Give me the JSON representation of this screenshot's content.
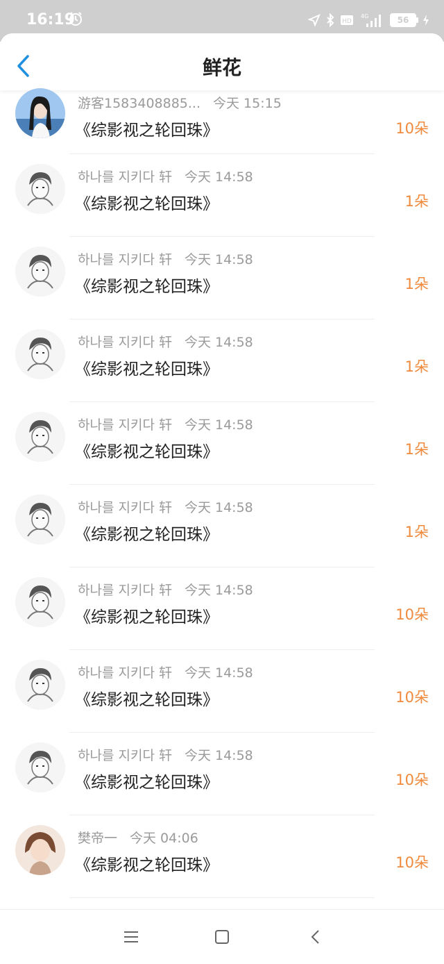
{
  "status_bar": {
    "time": "16:19",
    "battery": "56",
    "icons": [
      "alarm-icon",
      "location-icon",
      "bluetooth-icon",
      "hd-icon",
      "signal-4g-icon",
      "battery-icon",
      "charging-icon"
    ]
  },
  "header": {
    "title": "鲜花"
  },
  "items": [
    {
      "user": "游客1583408885...",
      "time": "今天 15:15",
      "book": "《综影视之轮回珠》",
      "count": "10朵"
    },
    {
      "user": "하나를 지키다 轩",
      "time": "今天 14:58",
      "book": "《综影视之轮回珠》",
      "count": "1朵"
    },
    {
      "user": "하나를 지키다 轩",
      "time": "今天 14:58",
      "book": "《综影视之轮回珠》",
      "count": "1朵"
    },
    {
      "user": "하나를 지키다 轩",
      "time": "今天 14:58",
      "book": "《综影视之轮回珠》",
      "count": "1朵"
    },
    {
      "user": "하나를 지키다 轩",
      "time": "今天 14:58",
      "book": "《综影视之轮回珠》",
      "count": "1朵"
    },
    {
      "user": "하나를 지키다 轩",
      "time": "今天 14:58",
      "book": "《综影视之轮回珠》",
      "count": "1朵"
    },
    {
      "user": "하나를 지키다 轩",
      "time": "今天 14:58",
      "book": "《综影视之轮回珠》",
      "count": "10朵"
    },
    {
      "user": "하나를 지키다 轩",
      "time": "今天 14:58",
      "book": "《综影视之轮回珠》",
      "count": "10朵"
    },
    {
      "user": "하나를 지키다 轩",
      "time": "今天 14:58",
      "book": "《综影视之轮回珠》",
      "count": "10朵"
    },
    {
      "user": "樊帝一",
      "time": "今天 04:06",
      "book": "《综影视之轮回珠》",
      "count": "10朵"
    }
  ],
  "colors": {
    "accent": "#1f8fe0",
    "count": "#f08a3c",
    "status_bar": "#cfcfcf"
  },
  "nav_buttons": [
    "menu-icon",
    "home-square-icon",
    "back-triangle-icon"
  ]
}
